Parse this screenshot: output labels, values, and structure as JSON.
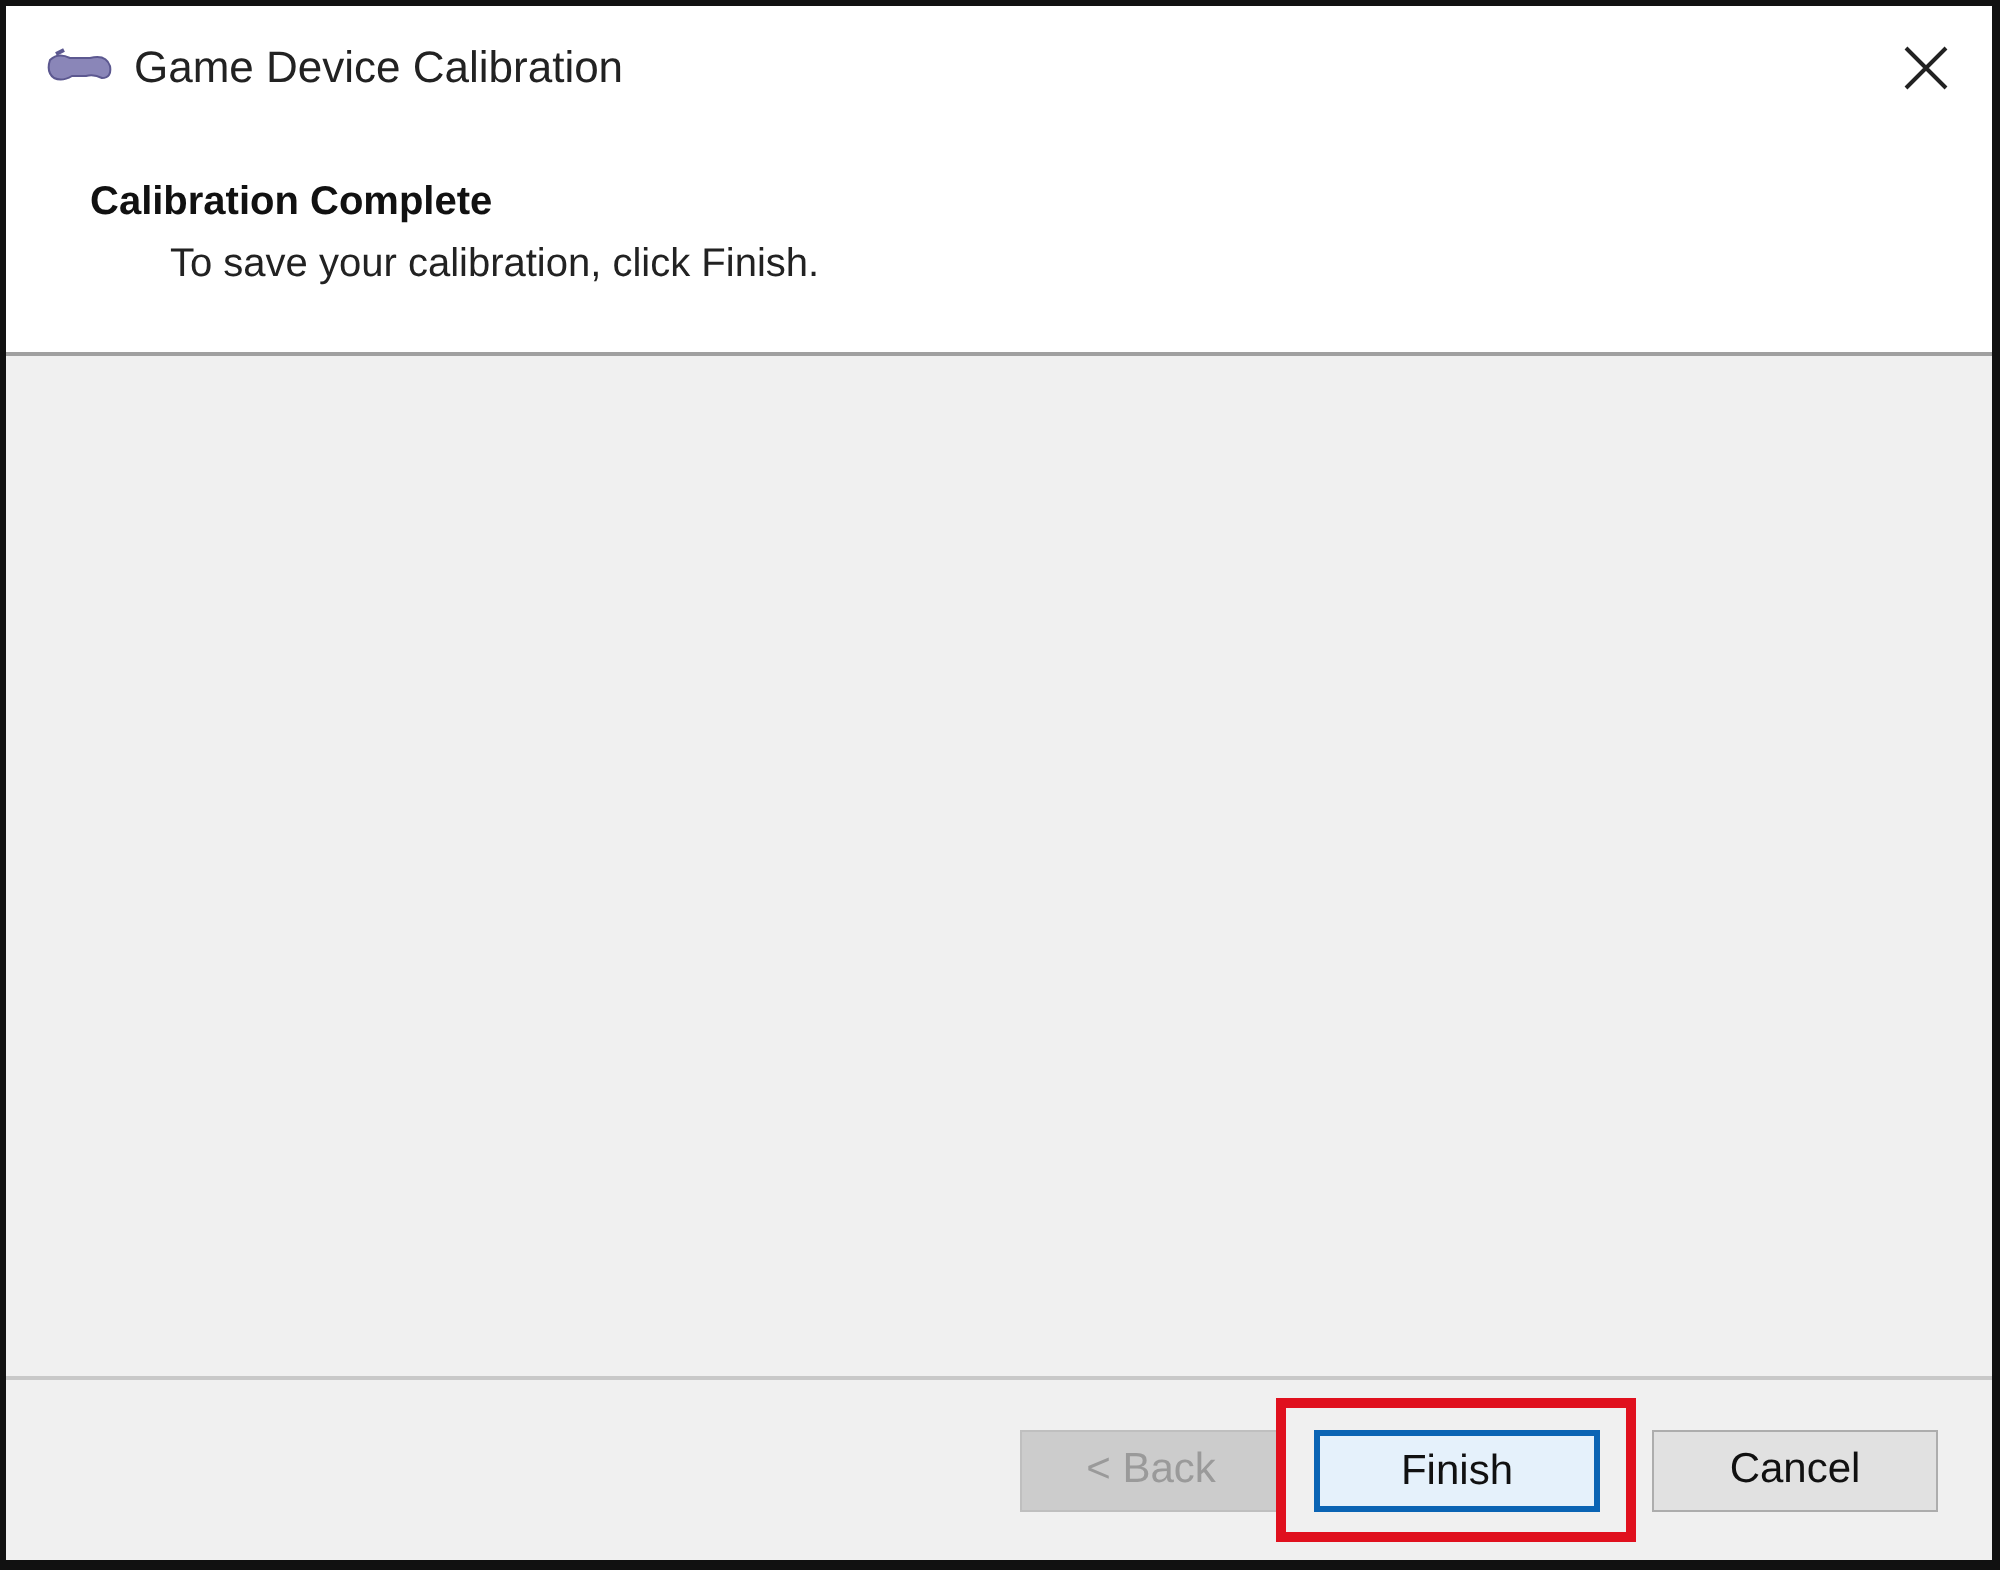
{
  "window": {
    "title": "Game Device Calibration"
  },
  "header": {
    "title": "Calibration Complete",
    "subtitle": "To save your calibration, click Finish."
  },
  "buttons": [
    {
      "label": "< Back",
      "disabled": true,
      "default": false,
      "highlighted": false
    },
    {
      "label": "Finish",
      "disabled": false,
      "default": true,
      "highlighted": true
    },
    {
      "label": "Cancel",
      "disabled": false,
      "default": false,
      "highlighted": false
    }
  ]
}
